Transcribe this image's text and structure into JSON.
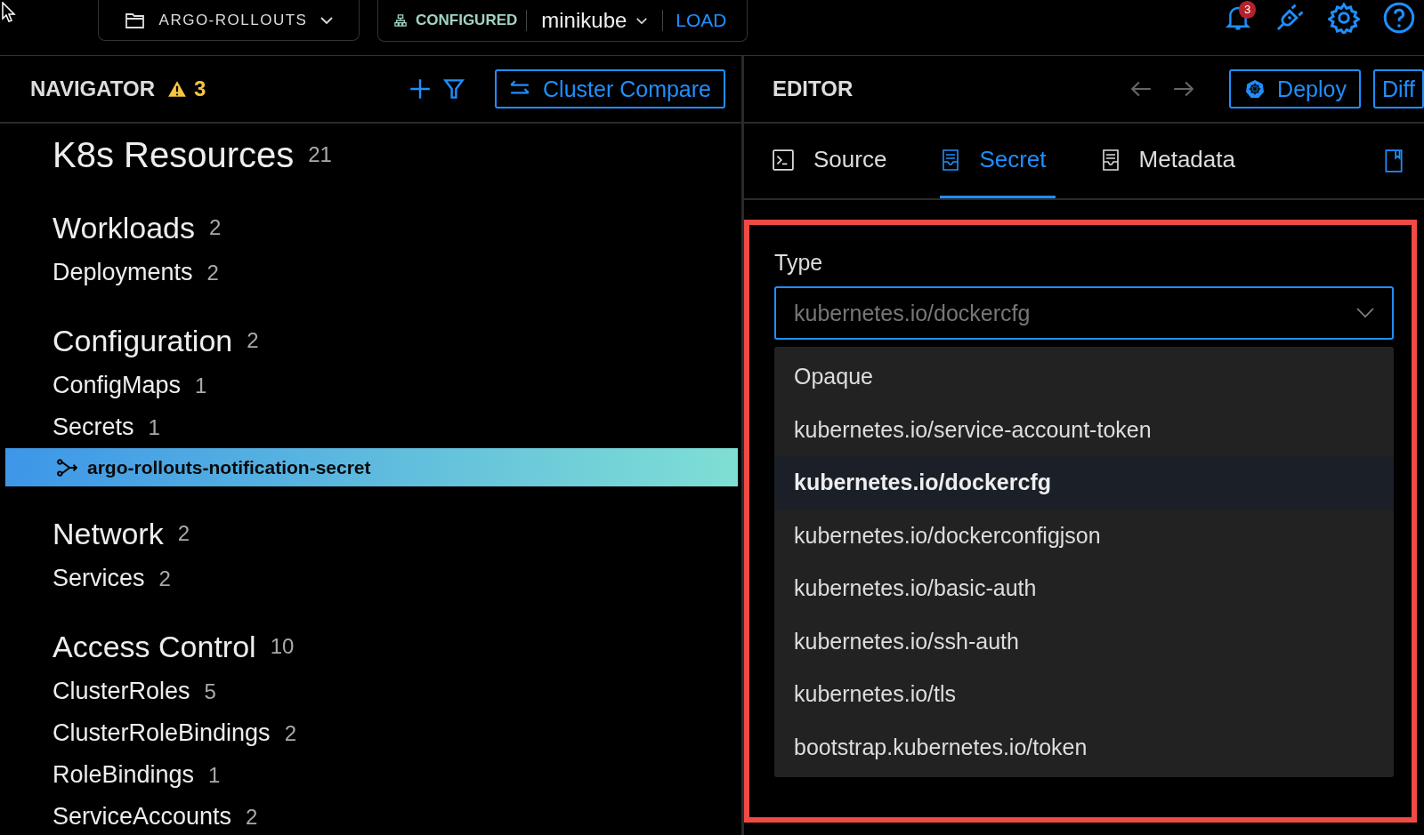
{
  "topbar": {
    "project": "ARGO-ROLLOUTS",
    "cluster_status": "CONFIGURED",
    "cluster": "minikube",
    "load": "LOAD",
    "notification_badge": "3"
  },
  "navigator": {
    "title": "NAVIGATOR",
    "warning_count": "3",
    "compare_button": "Cluster Compare",
    "sections": [
      {
        "name": "K8s Resources",
        "count": "21"
      },
      {
        "name": "Workloads",
        "count": "2",
        "children": [
          {
            "name": "Deployments",
            "count": "2"
          }
        ]
      },
      {
        "name": "Configuration",
        "count": "2",
        "children": [
          {
            "name": "ConfigMaps",
            "count": "1"
          },
          {
            "name": "Secrets",
            "count": "1",
            "children": [
              {
                "name": "argo-rollouts-notification-secret",
                "selected": true
              }
            ]
          }
        ]
      },
      {
        "name": "Network",
        "count": "2",
        "children": [
          {
            "name": "Services",
            "count": "2"
          }
        ]
      },
      {
        "name": "Access Control",
        "count": "10",
        "children": [
          {
            "name": "ClusterRoles",
            "count": "5"
          },
          {
            "name": "ClusterRoleBindings",
            "count": "2"
          },
          {
            "name": "RoleBindings",
            "count": "1"
          },
          {
            "name": "ServiceAccounts",
            "count": "2"
          }
        ]
      }
    ]
  },
  "editor": {
    "title": "EDITOR",
    "deploy_button": "Deploy",
    "diff_button": "Diff",
    "tabs": [
      {
        "label": "Source",
        "kind": "terminal",
        "selected": false
      },
      {
        "label": "Secret",
        "kind": "form",
        "selected": true
      },
      {
        "label": "Metadata",
        "kind": "form",
        "selected": false
      }
    ],
    "form": {
      "type_label": "Type",
      "type_value": "kubernetes.io/dockercfg",
      "options": [
        {
          "label": "Opaque",
          "selected": false
        },
        {
          "label": "kubernetes.io/service-account-token",
          "selected": false
        },
        {
          "label": "kubernetes.io/dockercfg",
          "selected": true
        },
        {
          "label": "kubernetes.io/dockerconfigjson",
          "selected": false
        },
        {
          "label": "kubernetes.io/basic-auth",
          "selected": false
        },
        {
          "label": "kubernetes.io/ssh-auth",
          "selected": false
        },
        {
          "label": "kubernetes.io/tls",
          "selected": false
        },
        {
          "label": "bootstrap.kubernetes.io/token",
          "selected": false
        }
      ]
    }
  }
}
